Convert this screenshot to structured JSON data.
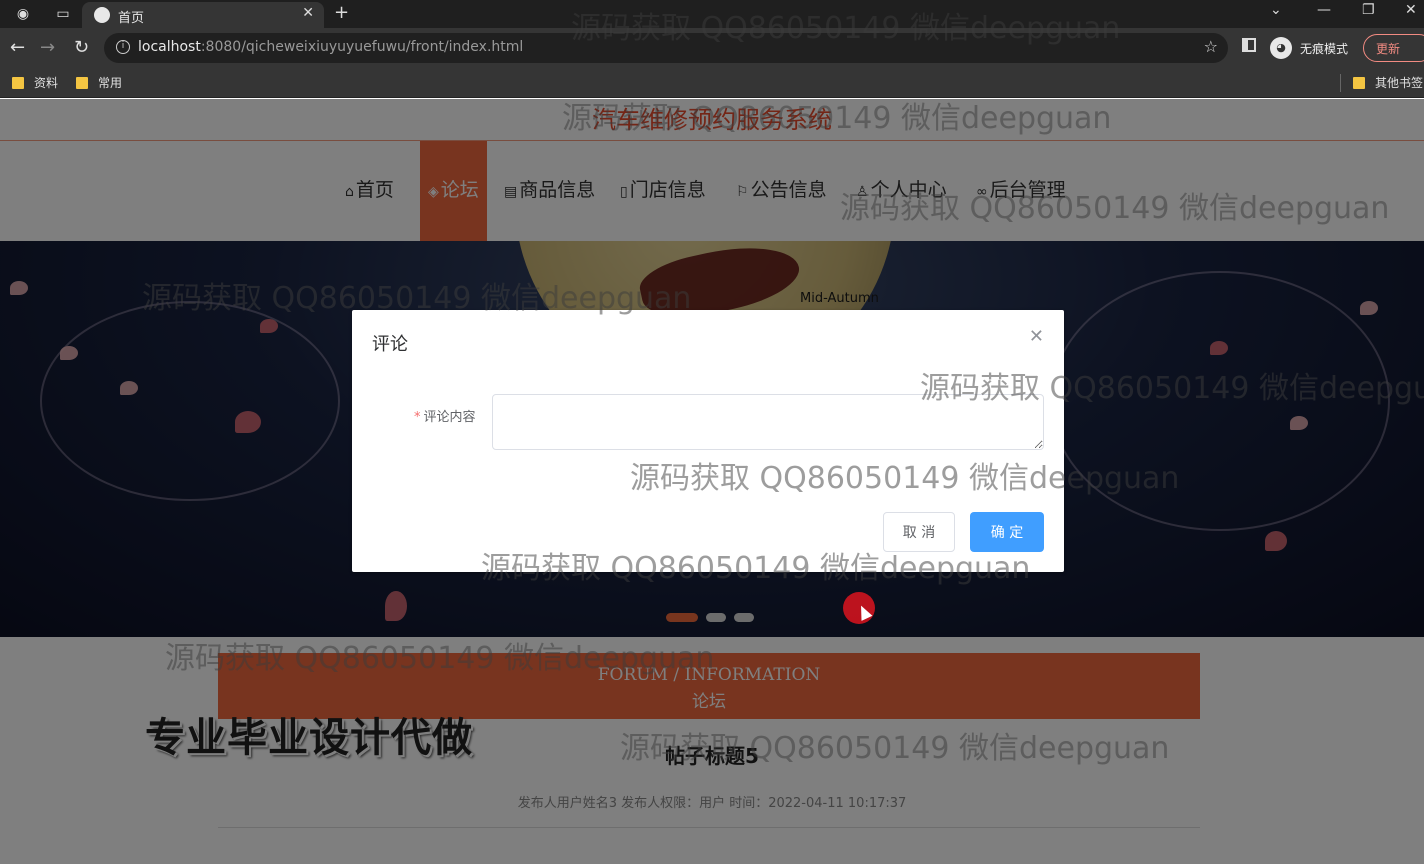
{
  "browser": {
    "tab_title": "首页",
    "url_host": "localhost",
    "url_rest": ":8080/qicheweixiuyuyuefuwu/front/index.html",
    "incognito_label": "无痕模式",
    "update_label": "更新",
    "bookmarks": [
      "资料",
      "常用"
    ],
    "other_bookmarks": "其他书签"
  },
  "site": {
    "title": "汽车维修预约服务系统",
    "nav": [
      {
        "label": "首页",
        "icon": "home-icon"
      },
      {
        "label": "论坛",
        "icon": "layers-icon"
      },
      {
        "label": "商品信息",
        "icon": "document-icon"
      },
      {
        "label": "门店信息",
        "icon": "film-icon"
      },
      {
        "label": "公告信息",
        "icon": "flag-icon"
      },
      {
        "label": "个人中心",
        "icon": "user-icon"
      },
      {
        "label": "后台管理",
        "icon": "link-icon"
      }
    ],
    "banner_text": "Mid-Autumn",
    "forum_en": "FORUM / INFORMATION",
    "forum_cn": "论坛",
    "post_title": "帖子标题5",
    "post_meta": "发布人用户姓名3   发布人权限：用户   时间：2022-04-11 10:17:37",
    "promo": "专业毕业设计代做"
  },
  "dialog": {
    "title": "评论",
    "field_label": "评论内容",
    "field_value": "",
    "cancel_label": "取 消",
    "confirm_label": "确 定"
  },
  "watermark": "源码获取 QQ86050149 微信deepguan",
  "colors": {
    "accent": "#f0683f",
    "primary_button": "#409eff"
  }
}
